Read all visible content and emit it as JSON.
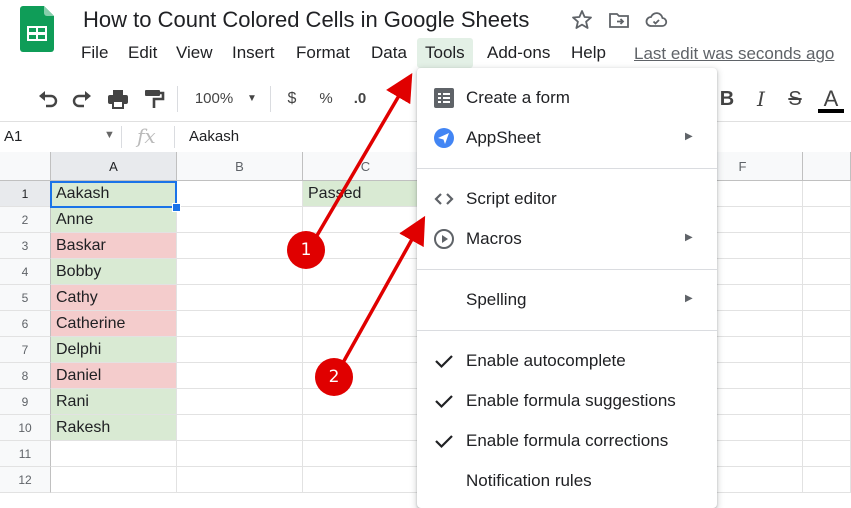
{
  "document": {
    "title": "How to Count Colored Cells in Google Sheets",
    "last_edit": "Last edit was seconds ago"
  },
  "menubar": [
    {
      "label": "File"
    },
    {
      "label": "Edit"
    },
    {
      "label": "View"
    },
    {
      "label": "Insert"
    },
    {
      "label": "Format"
    },
    {
      "label": "Data"
    },
    {
      "label": "Tools",
      "active": true
    },
    {
      "label": "Add-ons"
    },
    {
      "label": "Help"
    }
  ],
  "toolbar": {
    "zoom": "100%",
    "currency": "$",
    "percent": "%",
    "decimal": ".0",
    "bold": "B",
    "italic": "I",
    "strike": "S",
    "text_color": "A"
  },
  "formula_bar": {
    "cell_ref": "A1",
    "fx": "fx",
    "value": "Aakash"
  },
  "grid": {
    "columns": [
      "A",
      "B",
      "C",
      "F"
    ],
    "rows": [
      "1",
      "2",
      "3",
      "4",
      "5",
      "6",
      "7",
      "8",
      "9",
      "10",
      "11",
      "12"
    ],
    "column_a": [
      {
        "text": "Aakash",
        "color": "green"
      },
      {
        "text": "Anne",
        "color": "green"
      },
      {
        "text": "Baskar",
        "color": "red"
      },
      {
        "text": "Bobby",
        "color": "green"
      },
      {
        "text": "Cathy",
        "color": "red"
      },
      {
        "text": "Catherine",
        "color": "red"
      },
      {
        "text": "Delphi",
        "color": "green"
      },
      {
        "text": "Daniel",
        "color": "red"
      },
      {
        "text": "Rani",
        "color": "green"
      },
      {
        "text": "Rakesh",
        "color": "green"
      }
    ],
    "c1": "Passed"
  },
  "tools_menu": {
    "items": [
      {
        "label": "Create a form",
        "icon": "form-icon"
      },
      {
        "label": "AppSheet",
        "icon": "appsheet-icon",
        "submenu": true
      },
      {
        "label": "Script editor",
        "icon": "code-icon"
      },
      {
        "label": "Macros",
        "icon": "play-circle-icon",
        "submenu": true
      },
      {
        "label": "Spelling",
        "submenu": true
      },
      {
        "label": "Enable autocomplete",
        "checked": true
      },
      {
        "label": "Enable formula suggestions",
        "checked": true
      },
      {
        "label": "Enable formula corrections",
        "checked": true
      },
      {
        "label": "Notification rules"
      }
    ]
  },
  "annotations": {
    "badge_1": "1",
    "badge_2": "2"
  },
  "colors": {
    "green_fill": "#d9ead3",
    "red_fill": "#f4cccc",
    "selection": "#1a73e8",
    "annotation": "#e00000",
    "sheets_green": "#0f9d58"
  }
}
